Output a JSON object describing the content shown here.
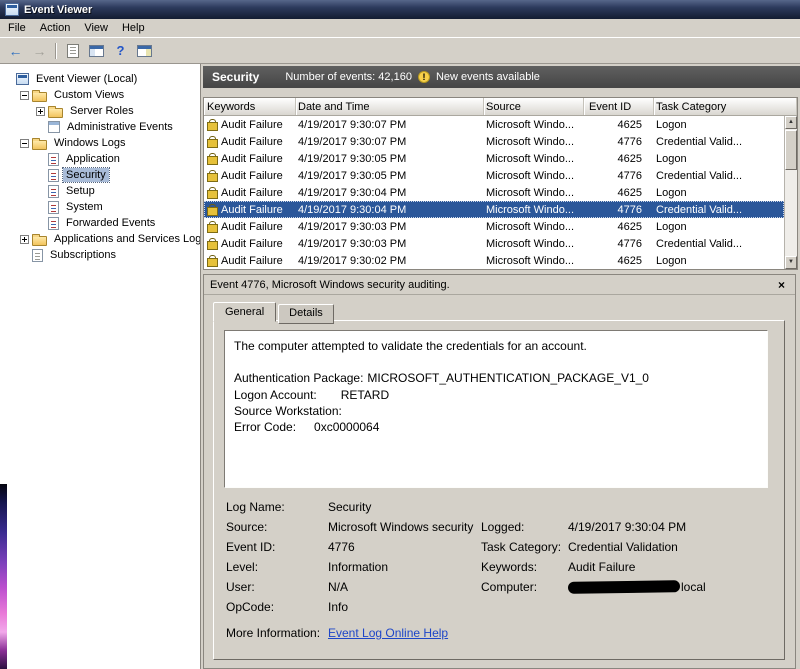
{
  "window": {
    "title": "Event Viewer",
    "menu": [
      "File",
      "Action",
      "View",
      "Help"
    ]
  },
  "icons": {
    "back": "←",
    "forward": "→",
    "help_glyph": "?",
    "close": "×",
    "alert_glyph": "!",
    "scroll_up": "▲",
    "scroll_down": "▼",
    "expand": "+",
    "collapse": "−",
    "lock": "padlock"
  },
  "colors": {
    "selection_blue": "#2b579a",
    "results_header_gray": "#4f4f4f",
    "lock_gold": "#e6c13a",
    "link_blue": "#1e46c8",
    "titlebar_navy": "#2c3a5c",
    "chrome_gray": "#d4d0c8"
  },
  "toolbar": {
    "buttons": [
      {
        "name": "back-button",
        "icon": "back-arrow-icon",
        "enabled": true
      },
      {
        "name": "forward-button",
        "icon": "forward-arrow-icon",
        "enabled": false
      },
      {
        "name": "separator"
      },
      {
        "name": "export-list-button",
        "icon": "document-icon",
        "enabled": true
      },
      {
        "name": "console-tree-toggle-button",
        "icon": "window-icon",
        "enabled": true
      },
      {
        "name": "help-button",
        "icon": "help-icon",
        "enabled": true
      },
      {
        "name": "action-pane-toggle-button",
        "icon": "monitor-icon",
        "enabled": true
      }
    ]
  },
  "tree": {
    "items": [
      {
        "label": "Event Viewer (Local)",
        "level": 0,
        "expand": "none",
        "icon": "root",
        "selected": false
      },
      {
        "label": "Custom Views",
        "level": 1,
        "expand": "minus",
        "icon": "folder",
        "selected": false
      },
      {
        "label": "Server Roles",
        "level": 2,
        "expand": "plus",
        "icon": "folder",
        "selected": false
      },
      {
        "label": "Administrative Events",
        "level": 2,
        "expand": "none",
        "icon": "view",
        "selected": false
      },
      {
        "label": "Windows Logs",
        "level": 1,
        "expand": "minus",
        "icon": "folder",
        "selected": false
      },
      {
        "label": "Application",
        "level": 2,
        "expand": "none",
        "icon": "log",
        "selected": false
      },
      {
        "label": "Security",
        "level": 2,
        "expand": "none",
        "icon": "log",
        "selected": true
      },
      {
        "label": "Setup",
        "level": 2,
        "expand": "none",
        "icon": "log",
        "selected": false
      },
      {
        "label": "System",
        "level": 2,
        "expand": "none",
        "icon": "log",
        "selected": false
      },
      {
        "label": "Forwarded Events",
        "level": 2,
        "expand": "none",
        "icon": "log",
        "selected": false
      },
      {
        "label": "Applications and Services Logs",
        "level": 1,
        "expand": "plus",
        "icon": "folder",
        "selected": false
      },
      {
        "label": "Subscriptions",
        "level": 1,
        "expand": "none",
        "icon": "subs",
        "selected": false
      }
    ]
  },
  "list": {
    "title": "Security",
    "count_text": "Number of events: 42,160",
    "new_events_text": "New events available",
    "columns": [
      "Keywords",
      "Date and Time",
      "Source",
      "Event ID",
      "Task Category"
    ],
    "rows": [
      {
        "keywords": "Audit Failure",
        "date_time": "4/19/2017 9:30:07 PM",
        "source": "Microsoft Windo...",
        "event_id": "4625",
        "task_category": "Logon",
        "selected": false
      },
      {
        "keywords": "Audit Failure",
        "date_time": "4/19/2017 9:30:07 PM",
        "source": "Microsoft Windo...",
        "event_id": "4776",
        "task_category": "Credential Valid...",
        "selected": false
      },
      {
        "keywords": "Audit Failure",
        "date_time": "4/19/2017 9:30:05 PM",
        "source": "Microsoft Windo...",
        "event_id": "4625",
        "task_category": "Logon",
        "selected": false
      },
      {
        "keywords": "Audit Failure",
        "date_time": "4/19/2017 9:30:05 PM",
        "source": "Microsoft Windo...",
        "event_id": "4776",
        "task_category": "Credential Valid...",
        "selected": false
      },
      {
        "keywords": "Audit Failure",
        "date_time": "4/19/2017 9:30:04 PM",
        "source": "Microsoft Windo...",
        "event_id": "4625",
        "task_category": "Logon",
        "selected": false
      },
      {
        "keywords": "Audit Failure",
        "date_time": "4/19/2017 9:30:04 PM",
        "source": "Microsoft Windo...",
        "event_id": "4776",
        "task_category": "Credential Valid...",
        "selected": true
      },
      {
        "keywords": "Audit Failure",
        "date_time": "4/19/2017 9:30:03 PM",
        "source": "Microsoft Windo...",
        "event_id": "4625",
        "task_category": "Logon",
        "selected": false
      },
      {
        "keywords": "Audit Failure",
        "date_time": "4/19/2017 9:30:03 PM",
        "source": "Microsoft Windo...",
        "event_id": "4776",
        "task_category": "Credential Valid...",
        "selected": false
      },
      {
        "keywords": "Audit Failure",
        "date_time": "4/19/2017 9:30:02 PM",
        "source": "Microsoft Windo...",
        "event_id": "4625",
        "task_category": "Logon",
        "selected": false
      }
    ]
  },
  "details": {
    "header_text": "Event 4776, Microsoft Windows security auditing.",
    "tabs": [
      "General",
      "Details"
    ],
    "active_tab": "General",
    "message_lines": [
      "The computer attempted to validate the credentials for an account.",
      "",
      "Authentication Package:\tMICROSOFT_AUTHENTICATION_PACKAGE_V1_0",
      "Logon Account:\tRETARD",
      "Source Workstation:",
      "Error Code:\t0xc0000064"
    ],
    "field_rows": [
      {
        "left": {
          "label": "Log Name:",
          "value": "Security"
        }
      },
      {
        "left": {
          "label": "Source:",
          "value": "Microsoft Windows security"
        },
        "right": {
          "label": "Logged:",
          "value": "4/19/2017 9:30:04 PM"
        }
      },
      {
        "left": {
          "label": "Event ID:",
          "value": "4776"
        },
        "right": {
          "label": "Task Category:",
          "value": "Credential Validation"
        }
      },
      {
        "left": {
          "label": "Level:",
          "value": "Information"
        },
        "right": {
          "label": "Keywords:",
          "value": "Audit Failure"
        }
      },
      {
        "left": {
          "label": "User:",
          "value": "N/A"
        },
        "right": {
          "label": "Computer:",
          "value": "local",
          "redacted": true
        }
      },
      {
        "left": {
          "label": "OpCode:",
          "value": "Info"
        }
      },
      {
        "left": {
          "label": "More Information:",
          "value": "Event Log Online Help",
          "link": true
        },
        "gap": true
      }
    ]
  }
}
